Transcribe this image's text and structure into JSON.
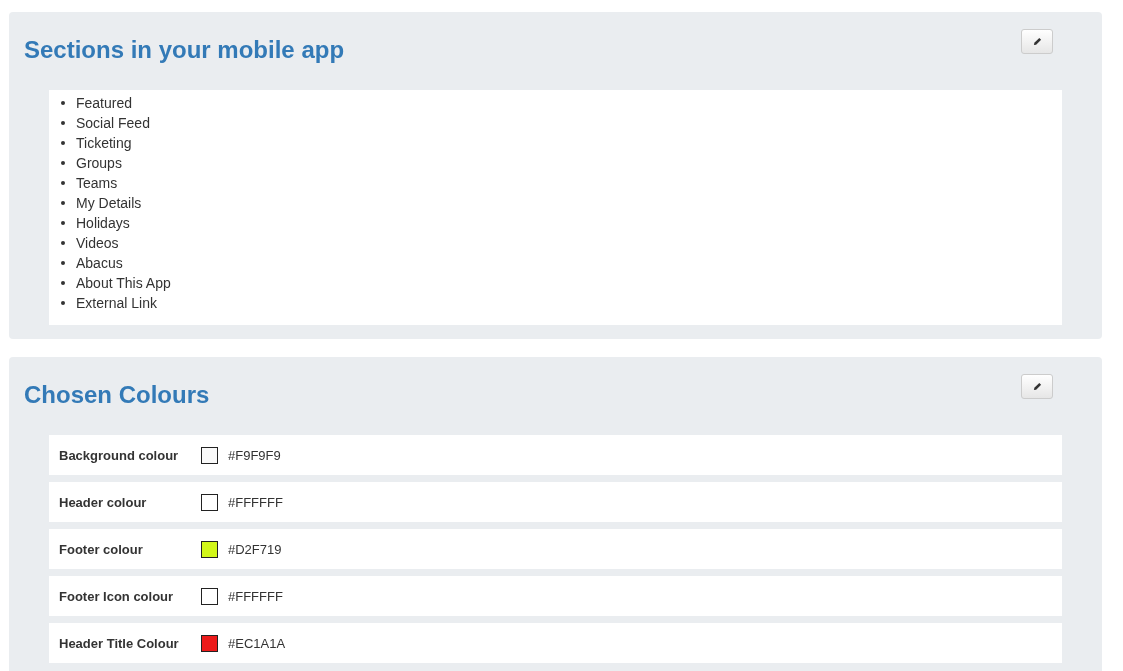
{
  "sections_panel": {
    "title": "Sections in your mobile app",
    "items": [
      "Featured",
      "Social Feed",
      "Ticketing",
      "Groups",
      "Teams",
      "My Details",
      "Holidays",
      "Videos",
      "Abacus",
      "About This App",
      "External Link"
    ]
  },
  "colours_panel": {
    "title": "Chosen Colours",
    "rows": [
      {
        "label": "Background colour",
        "value": "#F9F9F9",
        "color": "#f9f9f9"
      },
      {
        "label": "Header colour",
        "value": "#FFFFFF",
        "color": "#ffffff"
      },
      {
        "label": "Footer colour",
        "value": "#D2F719",
        "color": "#d2f719"
      },
      {
        "label": "Footer Icon colour",
        "value": "#FFFFFF",
        "color": "#ffffff"
      },
      {
        "label": "Header Title Colour",
        "value": "#EC1A1A",
        "color": "#ec1a1a"
      }
    ]
  }
}
